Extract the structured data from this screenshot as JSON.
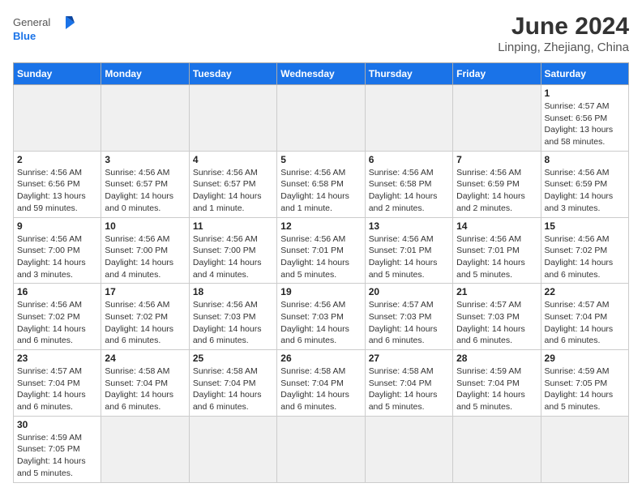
{
  "header": {
    "logo_general": "General",
    "logo_blue": "Blue",
    "title": "June 2024",
    "location": "Linping, Zhejiang, China"
  },
  "days_of_week": [
    "Sunday",
    "Monday",
    "Tuesday",
    "Wednesday",
    "Thursday",
    "Friday",
    "Saturday"
  ],
  "weeks": [
    [
      {
        "day": "",
        "info": ""
      },
      {
        "day": "",
        "info": ""
      },
      {
        "day": "",
        "info": ""
      },
      {
        "day": "",
        "info": ""
      },
      {
        "day": "",
        "info": ""
      },
      {
        "day": "",
        "info": ""
      },
      {
        "day": "1",
        "info": "Sunrise: 4:57 AM\nSunset: 6:56 PM\nDaylight: 13 hours and 58 minutes."
      }
    ],
    [
      {
        "day": "2",
        "info": "Sunrise: 4:56 AM\nSunset: 6:56 PM\nDaylight: 13 hours and 59 minutes."
      },
      {
        "day": "3",
        "info": "Sunrise: 4:56 AM\nSunset: 6:57 PM\nDaylight: 14 hours and 0 minutes."
      },
      {
        "day": "4",
        "info": "Sunrise: 4:56 AM\nSunset: 6:57 PM\nDaylight: 14 hours and 1 minute."
      },
      {
        "day": "5",
        "info": "Sunrise: 4:56 AM\nSunset: 6:58 PM\nDaylight: 14 hours and 1 minute."
      },
      {
        "day": "6",
        "info": "Sunrise: 4:56 AM\nSunset: 6:58 PM\nDaylight: 14 hours and 2 minutes."
      },
      {
        "day": "7",
        "info": "Sunrise: 4:56 AM\nSunset: 6:59 PM\nDaylight: 14 hours and 2 minutes."
      },
      {
        "day": "8",
        "info": "Sunrise: 4:56 AM\nSunset: 6:59 PM\nDaylight: 14 hours and 3 minutes."
      }
    ],
    [
      {
        "day": "9",
        "info": "Sunrise: 4:56 AM\nSunset: 7:00 PM\nDaylight: 14 hours and 3 minutes."
      },
      {
        "day": "10",
        "info": "Sunrise: 4:56 AM\nSunset: 7:00 PM\nDaylight: 14 hours and 4 minutes."
      },
      {
        "day": "11",
        "info": "Sunrise: 4:56 AM\nSunset: 7:00 PM\nDaylight: 14 hours and 4 minutes."
      },
      {
        "day": "12",
        "info": "Sunrise: 4:56 AM\nSunset: 7:01 PM\nDaylight: 14 hours and 5 minutes."
      },
      {
        "day": "13",
        "info": "Sunrise: 4:56 AM\nSunset: 7:01 PM\nDaylight: 14 hours and 5 minutes."
      },
      {
        "day": "14",
        "info": "Sunrise: 4:56 AM\nSunset: 7:01 PM\nDaylight: 14 hours and 5 minutes."
      },
      {
        "day": "15",
        "info": "Sunrise: 4:56 AM\nSunset: 7:02 PM\nDaylight: 14 hours and 6 minutes."
      }
    ],
    [
      {
        "day": "16",
        "info": "Sunrise: 4:56 AM\nSunset: 7:02 PM\nDaylight: 14 hours and 6 minutes."
      },
      {
        "day": "17",
        "info": "Sunrise: 4:56 AM\nSunset: 7:02 PM\nDaylight: 14 hours and 6 minutes."
      },
      {
        "day": "18",
        "info": "Sunrise: 4:56 AM\nSunset: 7:03 PM\nDaylight: 14 hours and 6 minutes."
      },
      {
        "day": "19",
        "info": "Sunrise: 4:56 AM\nSunset: 7:03 PM\nDaylight: 14 hours and 6 minutes."
      },
      {
        "day": "20",
        "info": "Sunrise: 4:57 AM\nSunset: 7:03 PM\nDaylight: 14 hours and 6 minutes."
      },
      {
        "day": "21",
        "info": "Sunrise: 4:57 AM\nSunset: 7:03 PM\nDaylight: 14 hours and 6 minutes."
      },
      {
        "day": "22",
        "info": "Sunrise: 4:57 AM\nSunset: 7:04 PM\nDaylight: 14 hours and 6 minutes."
      }
    ],
    [
      {
        "day": "23",
        "info": "Sunrise: 4:57 AM\nSunset: 7:04 PM\nDaylight: 14 hours and 6 minutes."
      },
      {
        "day": "24",
        "info": "Sunrise: 4:58 AM\nSunset: 7:04 PM\nDaylight: 14 hours and 6 minutes."
      },
      {
        "day": "25",
        "info": "Sunrise: 4:58 AM\nSunset: 7:04 PM\nDaylight: 14 hours and 6 minutes."
      },
      {
        "day": "26",
        "info": "Sunrise: 4:58 AM\nSunset: 7:04 PM\nDaylight: 14 hours and 6 minutes."
      },
      {
        "day": "27",
        "info": "Sunrise: 4:58 AM\nSunset: 7:04 PM\nDaylight: 14 hours and 5 minutes."
      },
      {
        "day": "28",
        "info": "Sunrise: 4:59 AM\nSunset: 7:04 PM\nDaylight: 14 hours and 5 minutes."
      },
      {
        "day": "29",
        "info": "Sunrise: 4:59 AM\nSunset: 7:05 PM\nDaylight: 14 hours and 5 minutes."
      }
    ],
    [
      {
        "day": "30",
        "info": "Sunrise: 4:59 AM\nSunset: 7:05 PM\nDaylight: 14 hours and 5 minutes."
      },
      {
        "day": "",
        "info": ""
      },
      {
        "day": "",
        "info": ""
      },
      {
        "day": "",
        "info": ""
      },
      {
        "day": "",
        "info": ""
      },
      {
        "day": "",
        "info": ""
      },
      {
        "day": "",
        "info": ""
      }
    ]
  ]
}
